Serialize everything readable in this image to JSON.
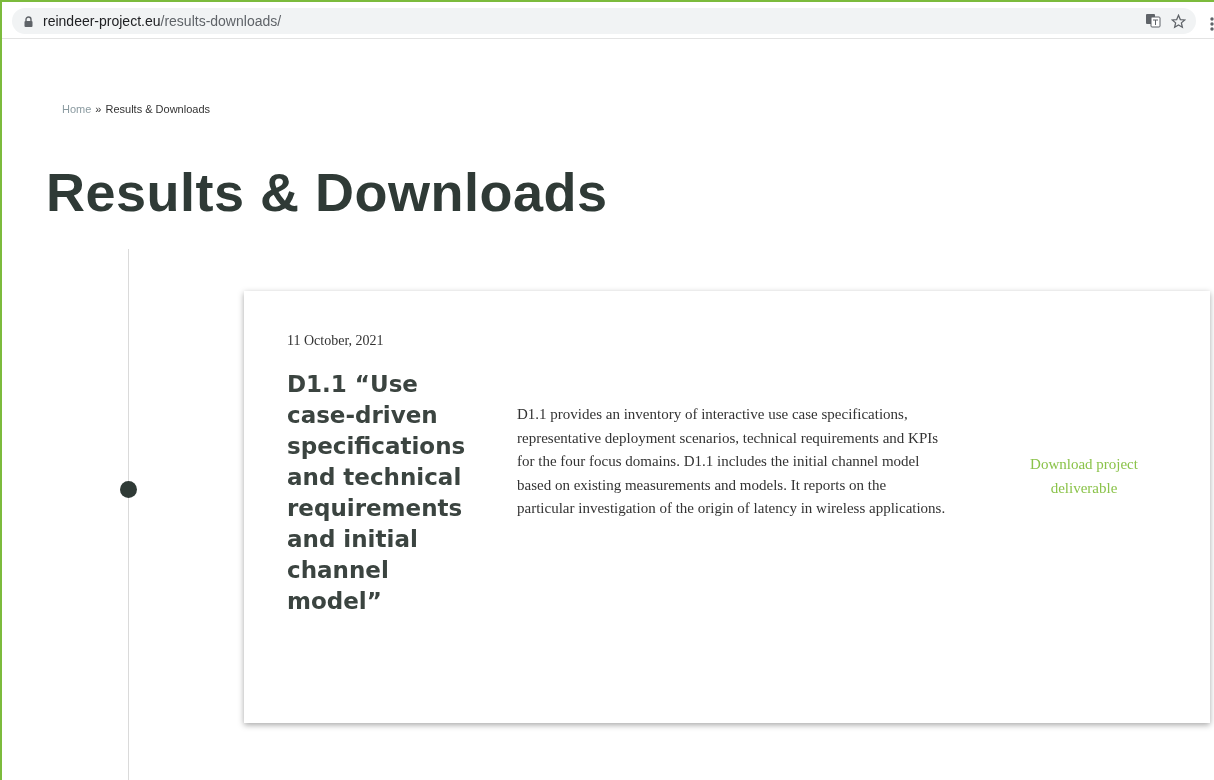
{
  "address_bar": {
    "domain": "reindeer-project.eu",
    "path": "/results-downloads/"
  },
  "breadcrumb": {
    "home": "Home",
    "separator": "»",
    "current": "Results & Downloads"
  },
  "page_title": "Results & Downloads",
  "entries": [
    {
      "date": "11 October, 2021",
      "title": "D1.1 “Use case-driven specifications and technical requirements and initial channel model”",
      "description": "D1.1 provides an inventory of interactive use case specifications, representative deployment scenarios, technical requirements and KPIs for the four focus domains. D1.1 includes the initial channel model based on existing measurements and models. It reports on the particular investigation of the origin of latency in wireless applications.",
      "link": "Download project deliverable"
    }
  ]
}
